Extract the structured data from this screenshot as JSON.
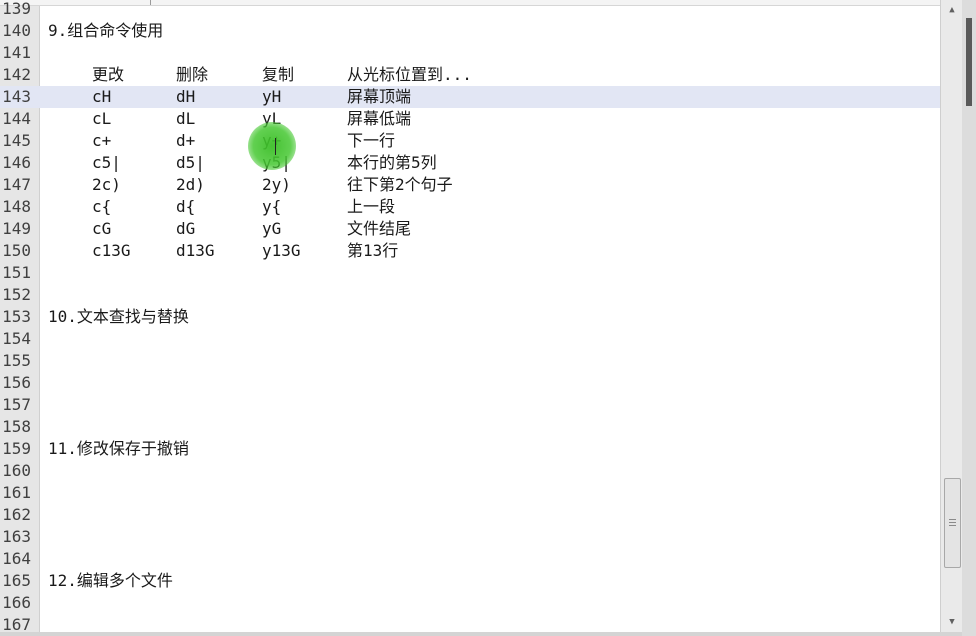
{
  "editor": {
    "current_line": 143,
    "lines": [
      {
        "n": "139",
        "text": ""
      },
      {
        "n": "140",
        "text": "9.组合命令使用"
      },
      {
        "n": "141",
        "text": ""
      },
      {
        "n": "142",
        "cols": [
          "更改",
          "删除",
          "复制",
          "从光标位置到..."
        ]
      },
      {
        "n": "143",
        "cols": [
          "cH",
          "dH",
          "yH",
          "屏幕顶端"
        ]
      },
      {
        "n": "144",
        "cols": [
          "cL",
          "dL",
          "yL",
          "屏幕低端"
        ]
      },
      {
        "n": "145",
        "cols": [
          "c+",
          "d+",
          "y+",
          "下一行"
        ]
      },
      {
        "n": "146",
        "cols": [
          "c5|",
          "d5|",
          "y5|",
          "本行的第5列"
        ]
      },
      {
        "n": "147",
        "cols": [
          "2c)",
          "2d)",
          "2y)",
          "往下第2个句子"
        ]
      },
      {
        "n": "148",
        "cols": [
          "c{",
          "d{",
          "y{",
          "上一段"
        ]
      },
      {
        "n": "149",
        "cols": [
          "cG",
          "dG",
          "yG",
          "文件结尾"
        ]
      },
      {
        "n": "150",
        "cols": [
          "c13G",
          "d13G",
          "y13G",
          "第13行"
        ]
      },
      {
        "n": "151",
        "text": ""
      },
      {
        "n": "152",
        "text": ""
      },
      {
        "n": "153",
        "text": "10.文本查找与替换"
      },
      {
        "n": "154",
        "text": ""
      },
      {
        "n": "155",
        "text": ""
      },
      {
        "n": "156",
        "text": ""
      },
      {
        "n": "157",
        "text": ""
      },
      {
        "n": "158",
        "text": ""
      },
      {
        "n": "159",
        "text": "11.修改保存于撤销"
      },
      {
        "n": "160",
        "text": ""
      },
      {
        "n": "161",
        "text": ""
      },
      {
        "n": "162",
        "text": ""
      },
      {
        "n": "163",
        "text": ""
      },
      {
        "n": "164",
        "text": ""
      },
      {
        "n": "165",
        "text": "12.编辑多个文件"
      },
      {
        "n": "166",
        "text": ""
      },
      {
        "n": "167",
        "text": ""
      }
    ]
  },
  "scrollbar": {
    "up_icon": "triangle-up-icon",
    "down_icon": "triangle-down-icon",
    "position_fraction": 0.82
  },
  "colors": {
    "current_line_bg": "#e2e6f4",
    "gutter_bg": "#e6e6e6",
    "cursor_highlight": "#3cbe28"
  }
}
